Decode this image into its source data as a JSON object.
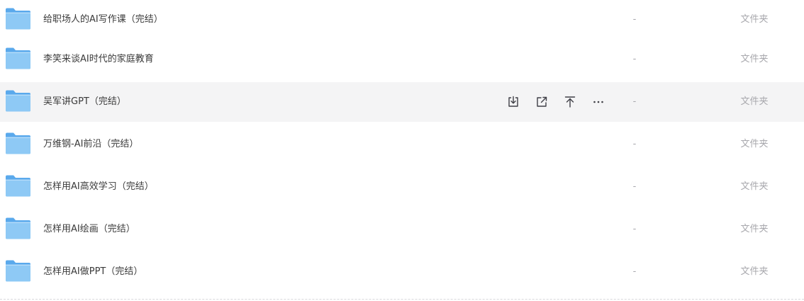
{
  "file_list": {
    "rows": [
      {
        "name": "给职场人的AI写作课（完结）",
        "size": "-",
        "type": "文件夹",
        "hovered": false
      },
      {
        "name": "李笑来谈AI时代的家庭教育",
        "size": "-",
        "type": "文件夹",
        "hovered": false
      },
      {
        "name": "吴军讲GPT（完结）",
        "size": "-",
        "type": "文件夹",
        "hovered": true
      },
      {
        "name": "万维钢-AI前沿（完结）",
        "size": "-",
        "type": "文件夹",
        "hovered": false
      },
      {
        "name": "怎样用AI高效学习（完结）",
        "size": "-",
        "type": "文件夹",
        "hovered": false
      },
      {
        "name": "怎样用AI绘画（完结）",
        "size": "-",
        "type": "文件夹",
        "hovered": false
      },
      {
        "name": "怎样用AI做PPT（完结）",
        "size": "-",
        "type": "文件夹",
        "hovered": false
      }
    ],
    "row_actions": [
      {
        "icon": "download-icon"
      },
      {
        "icon": "share-icon"
      },
      {
        "icon": "pin-to-top-icon"
      },
      {
        "icon": "more-icon"
      }
    ]
  },
  "colors": {
    "hover_background": "#f4f4f5",
    "folder_light": "#8ec9f5",
    "folder_dark": "#5aa9ec",
    "text_primary": "#3a3a3a",
    "text_secondary": "#a8a8ad",
    "icon": "#3f3f46"
  }
}
